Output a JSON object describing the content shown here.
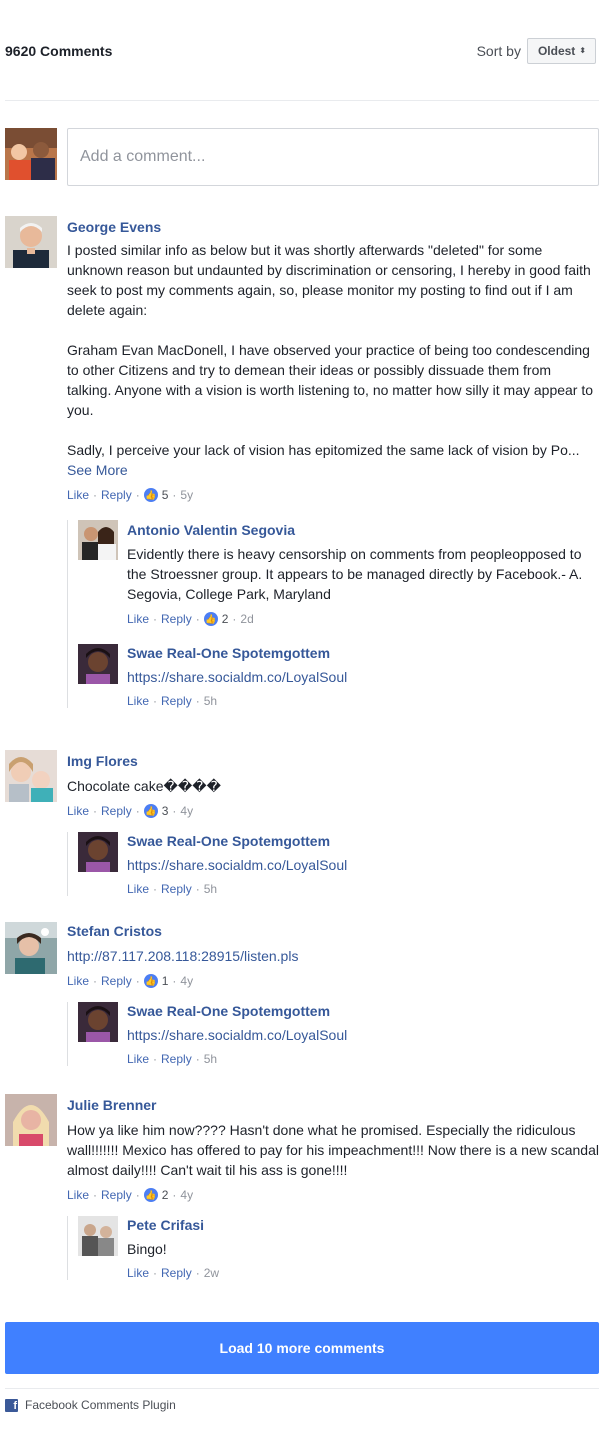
{
  "header": {
    "count": "9620 Comments",
    "sort_label": "Sort by",
    "sort_value": "Oldest",
    "sort_arrows": "⬍"
  },
  "composer": {
    "placeholder": "Add a comment..."
  },
  "comments": [
    {
      "author": "George Evens",
      "text": "I posted similar info as below but it was shortly afterwards \"deleted\" for some unknown reason but undaunted by discrimination or censoring, I hereby in good faith seek to post my comments again, so, please monitor my posting to find out if I am delete again:\n\nGraham Evan MacDonell, I have observed your practice of being too condescending to other Citizens and try to demean their ideas or possibly dissuade them from talking. Anyone with a vision is worth listening to, no matter how silly it may appear to you.\n\nSadly, I perceive your lack of vision has epitomized the same lack of vision by Po...",
      "see_more": "See More",
      "like": "Like",
      "reply": "Reply",
      "likes": "5",
      "time": "5y",
      "replies": [
        {
          "author": "Antonio Valentin Segovia",
          "text": "Evidently there is heavy censorship on comments from peopleopposed to the Stroessner group. It appears to be managed directly by Facebook.- A. Segovia, College Park, Maryland",
          "like": "Like",
          "reply": "Reply",
          "likes": "2",
          "time": "2d"
        },
        {
          "author": "Swae Real-One Spotemgottem",
          "link": "https://share.socialdm.co/LoyalSoul",
          "like": "Like",
          "reply": "Reply",
          "time": "5h"
        }
      ]
    },
    {
      "author": "Img Flores",
      "text": "Chocolate cake����",
      "like": "Like",
      "reply": "Reply",
      "likes": "3",
      "time": "4y",
      "replies": [
        {
          "author": "Swae Real-One Spotemgottem",
          "link": "https://share.socialdm.co/LoyalSoul",
          "like": "Like",
          "reply": "Reply",
          "time": "5h"
        }
      ]
    },
    {
      "author": "Stefan Cristos",
      "link": "http://87.117.208.118:28915/listen.pls",
      "like": "Like",
      "reply": "Reply",
      "likes": "1",
      "time": "4y",
      "replies": [
        {
          "author": "Swae Real-One Spotemgottem",
          "link": "https://share.socialdm.co/LoyalSoul",
          "like": "Like",
          "reply": "Reply",
          "time": "5h"
        }
      ]
    },
    {
      "author": "Julie Brenner",
      "text": "How ya like him now???? Hasn't done what he promised. Especially the ridiculous wall!!!!!!! Mexico has offered to pay for his impeachment!!! Now there is a new scandal almost daily!!!! Can't wait til his ass is gone!!!!",
      "like": "Like",
      "reply": "Reply",
      "likes": "2",
      "time": "4y",
      "replies": [
        {
          "author": "Pete Crifasi",
          "text": "Bingo!",
          "like": "Like",
          "reply": "Reply",
          "time": "2w"
        }
      ]
    }
  ],
  "load_more": "Load 10 more comments",
  "footer": {
    "icon_letter": "f",
    "label": "Facebook Comments Plugin"
  },
  "sep": "·",
  "thumb": "👍",
  "colors": {
    "link": "#365899",
    "button": "#4080ff",
    "like_badge": "#4c7ef3"
  }
}
